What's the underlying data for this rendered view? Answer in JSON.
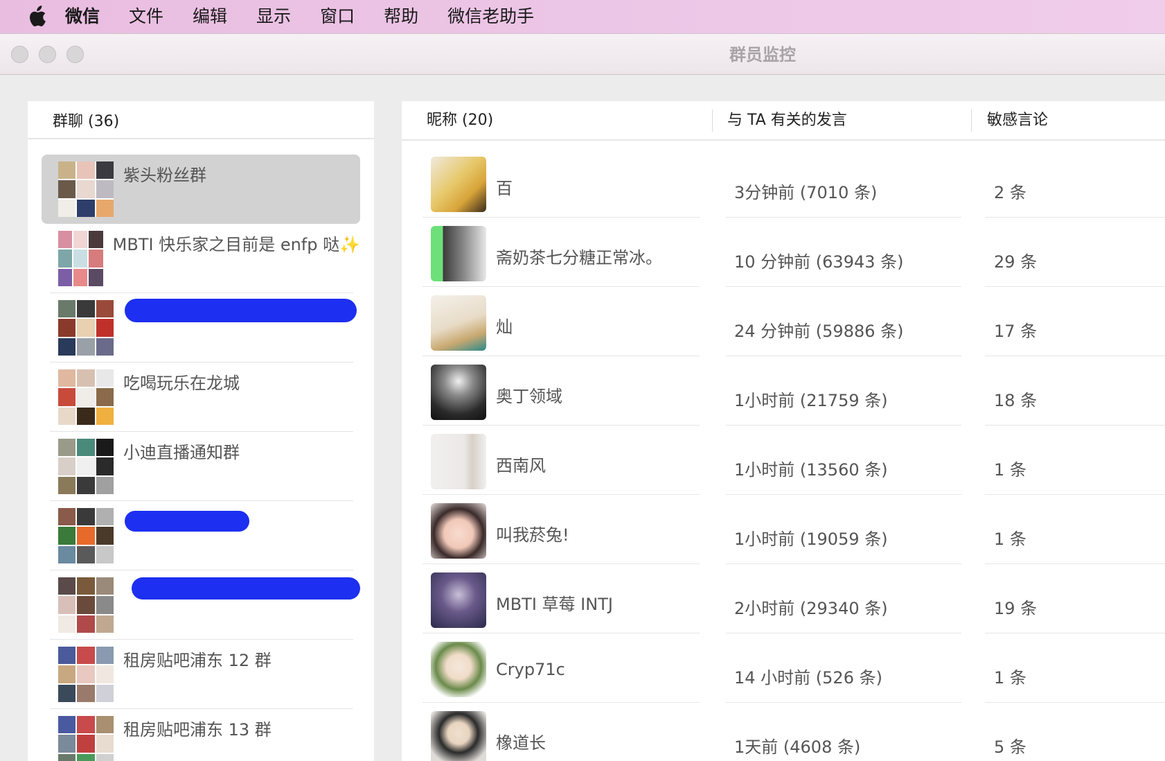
{
  "menubar": {
    "items": [
      "微信",
      "文件",
      "编辑",
      "显示",
      "窗口",
      "帮助",
      "微信老助手"
    ]
  },
  "window": {
    "title": "群员监控"
  },
  "groups": {
    "header": "群聊 (36)",
    "items": [
      {
        "name": "紫头粉丝群",
        "selected": true
      },
      {
        "name": "MBTI 快乐家之目前是 enfp 哒✨"
      },
      {
        "name": "",
        "redacted": true
      },
      {
        "name": "吃喝玩乐在龙城"
      },
      {
        "name": "小迪直播通知群"
      },
      {
        "name": "",
        "redacted": true
      },
      {
        "name": "",
        "redacted": true
      },
      {
        "name": "租房贴吧浦东 12 群"
      },
      {
        "name": "租房贴吧浦东 13 群"
      }
    ]
  },
  "members": {
    "columns": {
      "nickname": "昵称 (20)",
      "messages": "与 TA 有关的发言",
      "sensitive": "敏感言论"
    },
    "rows": [
      {
        "nickname": "百",
        "last": "3分钟前 (7010 条)",
        "sensitive": "2 条"
      },
      {
        "nickname": "斋奶茶七分糖正常冰。",
        "last": "10 分钟前 (63943 条)",
        "sensitive": "29 条"
      },
      {
        "nickname": "灿",
        "last": "24 分钟前 (59886 条)",
        "sensitive": "17 条"
      },
      {
        "nickname": "奥丁领域",
        "last": "1小时前 (21759 条)",
        "sensitive": "18 条"
      },
      {
        "nickname": "西南风",
        "last": "1小时前 (13560 条)",
        "sensitive": "1 条"
      },
      {
        "nickname": "叫我菸兔!",
        "last": "1小时前 (19059 条)",
        "sensitive": "1 条"
      },
      {
        "nickname": "MBTI 草莓 INTJ",
        "last": "2小时前 (29340 条)",
        "sensitive": "19 条"
      },
      {
        "nickname": "Cryp71c",
        "last": "14 小时前 (526 条)",
        "sensitive": "1 条"
      },
      {
        "nickname": "橡道长",
        "last": "1天前 (4608 条)",
        "sensitive": "5 条"
      }
    ]
  },
  "colors": {
    "menubar": "#ecc6e6",
    "selected_row": "#d2d2d2",
    "redaction": "#1d2ff0"
  }
}
